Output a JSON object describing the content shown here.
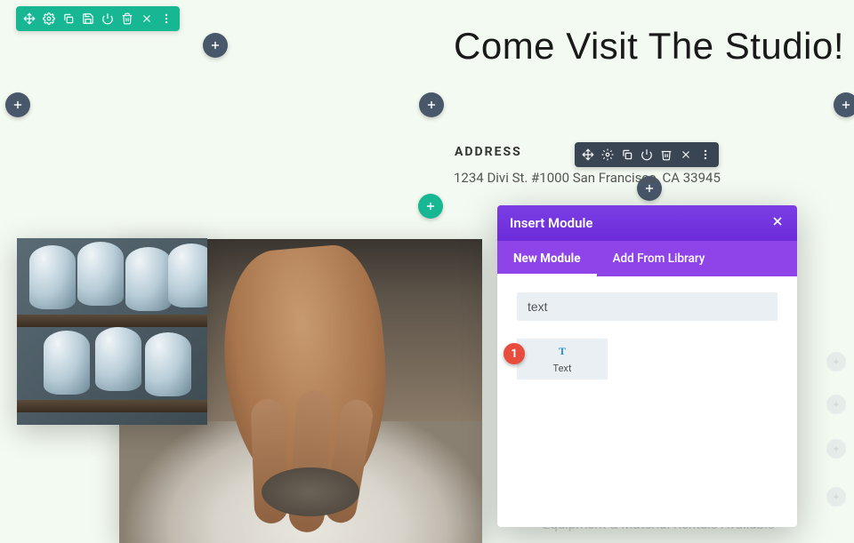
{
  "heading": "Come Visit The Studio!",
  "subheading_label": "ADDRESS",
  "address_text": "1234 Divi St. #1000 San Francisco, CA 33945",
  "footer_ghost_text": "Equipment & Material Rentals Available",
  "modal": {
    "title": "Insert Module",
    "tabs": {
      "new_module": "New Module",
      "add_from_library": "Add From Library"
    },
    "search_value": "text",
    "modules": {
      "text_label": "Text"
    }
  },
  "marker": {
    "one": "1"
  },
  "colors": {
    "teal": "#17b794",
    "purple": "#7b3fe4",
    "purple_tab": "#8e44e8",
    "dark_toolbar": "#3a4554",
    "marker_red": "#e74c3c"
  }
}
